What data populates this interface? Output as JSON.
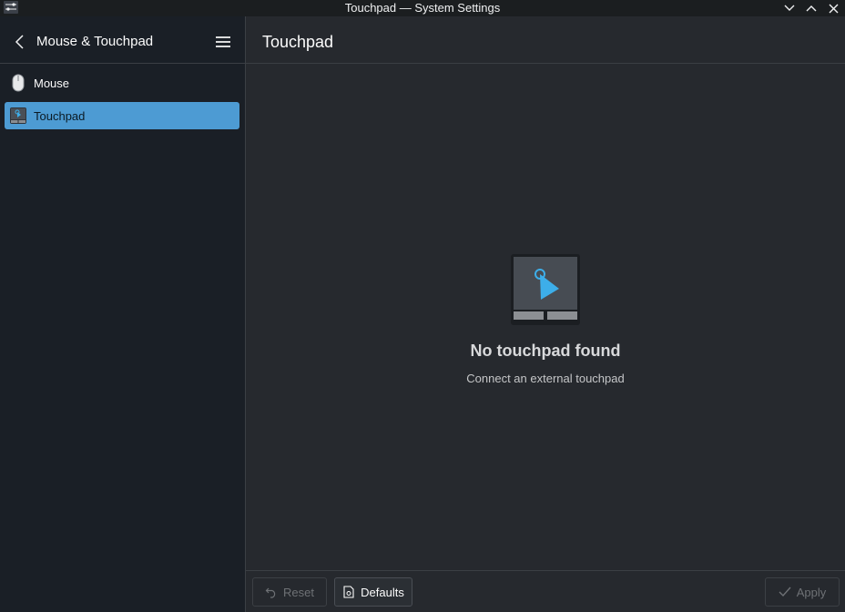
{
  "window": {
    "title": "Touchpad — System Settings"
  },
  "sidebar": {
    "title": "Mouse & Touchpad",
    "items": [
      {
        "label": "Mouse",
        "icon": "mouse-icon",
        "selected": false
      },
      {
        "label": "Touchpad",
        "icon": "touchpad-icon",
        "selected": true
      }
    ]
  },
  "main": {
    "title": "Touchpad",
    "empty_state": {
      "icon": "touchpad-placeholder-icon",
      "heading": "No touchpad found",
      "message": "Connect an external touchpad"
    }
  },
  "footer": {
    "reset_label": "Reset",
    "defaults_label": "Defaults",
    "apply_label": "Apply"
  },
  "colors": {
    "accent": "#4d9bd3",
    "sidebar_bg": "#1a1f26",
    "main_bg": "#26292e",
    "titlebar_bg": "#1b1e20"
  }
}
